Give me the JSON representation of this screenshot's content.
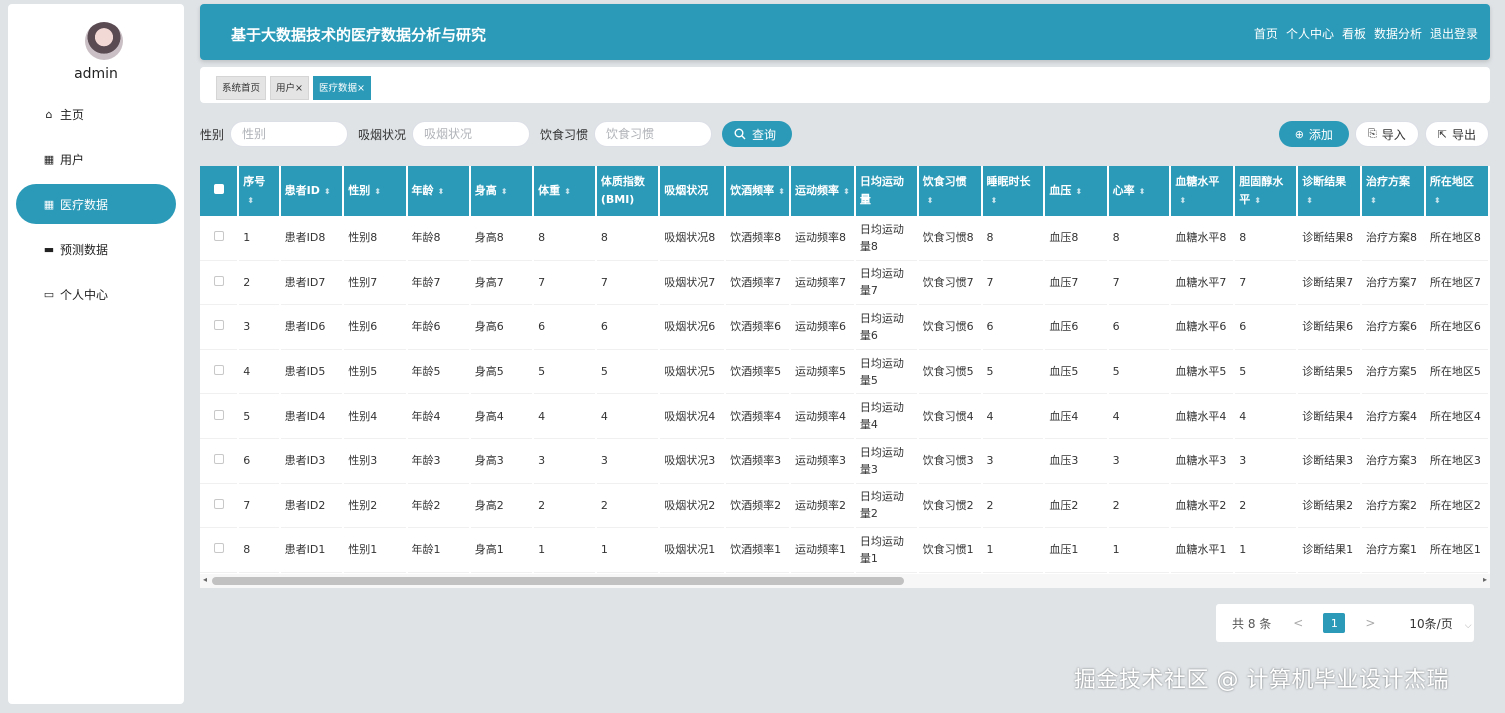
{
  "user": {
    "name": "admin"
  },
  "sidebar": {
    "items": [
      {
        "label": "主页",
        "icon": "home-icon",
        "active": false
      },
      {
        "label": "用户",
        "icon": "grid-icon",
        "active": false
      },
      {
        "label": "医疗数据",
        "icon": "grid-icon",
        "active": true
      },
      {
        "label": "预测数据",
        "icon": "chat-icon",
        "active": false
      },
      {
        "label": "个人中心",
        "icon": "card-icon",
        "active": false
      }
    ]
  },
  "header": {
    "title": "基于大数据技术的医疗数据分析与研究",
    "nav": [
      "首页",
      "个人中心",
      "看板",
      "数据分析",
      "退出登录"
    ]
  },
  "tabs": [
    {
      "label": "系统首页",
      "active": false
    },
    {
      "label": "用户×",
      "active": false
    },
    {
      "label": "医疗数据×",
      "active": true
    }
  ],
  "search": {
    "gender_label": "性别",
    "gender_placeholder": "性别",
    "smoking_label": "吸烟状况",
    "smoking_placeholder": "吸烟状况",
    "diet_label": "饮食习惯",
    "diet_placeholder": "饮食习惯",
    "query_label": "查询"
  },
  "actions": {
    "add": "添加",
    "import": "导入",
    "export": "导出"
  },
  "table": {
    "columns": [
      "序号",
      "患者ID",
      "性别",
      "年龄",
      "身高",
      "体重",
      "体质指数(BMI)",
      "吸烟状况",
      "饮酒频率",
      "运动频率",
      "日均运动量",
      "饮食习惯",
      "睡眠时长",
      "血压",
      "心率",
      "血糖水平",
      "胆固醇水平",
      "诊断结果",
      "治疗方案",
      "所在地区"
    ],
    "rows": [
      [
        "1",
        "患者ID8",
        "性别8",
        "年龄8",
        "身高8",
        "8",
        "8",
        "吸烟状况8",
        "饮酒频率8",
        "运动频率8",
        "日均运动量8",
        "饮食习惯8",
        "8",
        "血压8",
        "8",
        "血糖水平8",
        "8",
        "诊断结果8",
        "治疗方案8",
        "所在地区8"
      ],
      [
        "2",
        "患者ID7",
        "性别7",
        "年龄7",
        "身高7",
        "7",
        "7",
        "吸烟状况7",
        "饮酒频率7",
        "运动频率7",
        "日均运动量7",
        "饮食习惯7",
        "7",
        "血压7",
        "7",
        "血糖水平7",
        "7",
        "诊断结果7",
        "治疗方案7",
        "所在地区7"
      ],
      [
        "3",
        "患者ID6",
        "性别6",
        "年龄6",
        "身高6",
        "6",
        "6",
        "吸烟状况6",
        "饮酒频率6",
        "运动频率6",
        "日均运动量6",
        "饮食习惯6",
        "6",
        "血压6",
        "6",
        "血糖水平6",
        "6",
        "诊断结果6",
        "治疗方案6",
        "所在地区6"
      ],
      [
        "4",
        "患者ID5",
        "性别5",
        "年龄5",
        "身高5",
        "5",
        "5",
        "吸烟状况5",
        "饮酒频率5",
        "运动频率5",
        "日均运动量5",
        "饮食习惯5",
        "5",
        "血压5",
        "5",
        "血糖水平5",
        "5",
        "诊断结果5",
        "治疗方案5",
        "所在地区5"
      ],
      [
        "5",
        "患者ID4",
        "性别4",
        "年龄4",
        "身高4",
        "4",
        "4",
        "吸烟状况4",
        "饮酒频率4",
        "运动频率4",
        "日均运动量4",
        "饮食习惯4",
        "4",
        "血压4",
        "4",
        "血糖水平4",
        "4",
        "诊断结果4",
        "治疗方案4",
        "所在地区4"
      ],
      [
        "6",
        "患者ID3",
        "性别3",
        "年龄3",
        "身高3",
        "3",
        "3",
        "吸烟状况3",
        "饮酒频率3",
        "运动频率3",
        "日均运动量3",
        "饮食习惯3",
        "3",
        "血压3",
        "3",
        "血糖水平3",
        "3",
        "诊断结果3",
        "治疗方案3",
        "所在地区3"
      ],
      [
        "7",
        "患者ID2",
        "性别2",
        "年龄2",
        "身高2",
        "2",
        "2",
        "吸烟状况2",
        "饮酒频率2",
        "运动频率2",
        "日均运动量2",
        "饮食习惯2",
        "2",
        "血压2",
        "2",
        "血糖水平2",
        "2",
        "诊断结果2",
        "治疗方案2",
        "所在地区2"
      ],
      [
        "8",
        "患者ID1",
        "性别1",
        "年龄1",
        "身高1",
        "1",
        "1",
        "吸烟状况1",
        "饮酒频率1",
        "运动频率1",
        "日均运动量1",
        "饮食习惯1",
        "1",
        "血压1",
        "1",
        "血糖水平1",
        "1",
        "诊断结果1",
        "治疗方案1",
        "所在地区1"
      ]
    ]
  },
  "pagination": {
    "total": "共 8 条",
    "prev": "<",
    "current": "1",
    "next": ">",
    "page_size": "10条/页"
  },
  "watermark": "掘金技术社区 @ 计算机毕业设计杰瑞",
  "colors": {
    "accent": "#2a9ab8",
    "background": "#dfe3e6"
  }
}
